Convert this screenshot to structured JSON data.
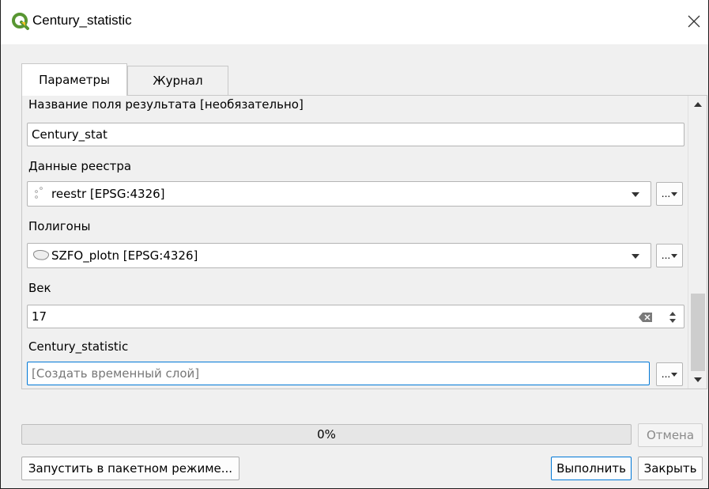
{
  "window": {
    "title": "Century_statistic",
    "close_icon": "close-icon",
    "logo_icon": "qgis-logo-icon",
    "accent_color": "#589632"
  },
  "tabs": [
    {
      "label": "Параметры",
      "active": true
    },
    {
      "label": "Журнал",
      "active": false
    }
  ],
  "params": {
    "result_field_label": "Название поля результата [необязательно]",
    "result_field_value": "Century_stat",
    "registry_label": "Данные реестра",
    "registry_value": "reestr [EPSG:4326]",
    "registry_icon": "point-layer-icon",
    "polygons_label": "Полигоны",
    "polygons_value": "SZFO_plotn [EPSG:4326]",
    "polygons_icon": "polygon-layer-icon",
    "century_label": "Век",
    "century_value": "17",
    "output_label": "Century_statistic",
    "output_placeholder": "[Создать временный слой]",
    "dots_label": "..."
  },
  "footer": {
    "progress_text": "0%",
    "progress_value": 0,
    "cancel_label": "Отмена",
    "batch_label": "Запустить в пакетном режиме...",
    "run_label": "Выполнить",
    "close_label": "Закрыть"
  }
}
